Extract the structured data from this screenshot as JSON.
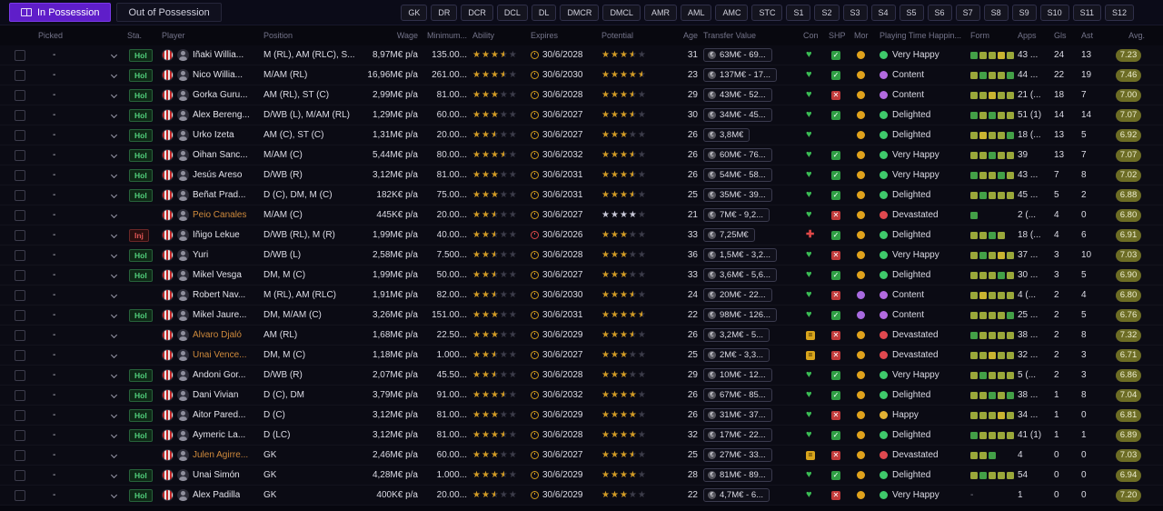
{
  "topbar": {
    "tabs": [
      {
        "label": "In Possession",
        "active": true
      },
      {
        "label": "Out of Possession",
        "active": false
      }
    ],
    "filters": [
      "GK",
      "DR",
      "DCR",
      "DCL",
      "DL",
      "DMCR",
      "DMCL",
      "AMR",
      "AML",
      "AMC",
      "STC",
      "S1",
      "S2",
      "S3",
      "S4",
      "S5",
      "S6",
      "S7",
      "S8",
      "S9",
      "S10",
      "S11",
      "S12"
    ]
  },
  "icons": {
    "star": "★",
    "heart": "♥",
    "check": "✓",
    "cross": "✕",
    "injured": "✚",
    "warning": "=",
    "coin": "€",
    "chevron": "v",
    "clock": "clock-face",
    "club_crest": "red-white-striped-circle",
    "avatar": "person-silhouette"
  },
  "colors": {
    "accent_purple": "#5f1ec9",
    "star_gold": "#d19b26",
    "avg_pill": "#6d6d25",
    "hol_green": "#52d07c",
    "inj_red": "#e05555",
    "listed_orange": "#cf8a3c",
    "happy_green": "#3fc96b",
    "content_purple": "#b26ae0",
    "devastated_red": "#e0484f",
    "happy_yellow": "#e3b133"
  },
  "table": {
    "columns": [
      "",
      "Picked",
      "Sta.",
      "Player",
      "Position",
      "Wage",
      "Minimum...",
      "Ability",
      "Expires",
      "Potential",
      "Age",
      "Transfer Value",
      "Con",
      "SHP",
      "Mor",
      "Playing Time Happin...",
      "Form",
      "Apps",
      "Gls",
      "Ast",
      "Avg."
    ],
    "rows": [
      {
        "picked": "-",
        "sta": "Hol",
        "name": "Iñaki Willia...",
        "listed": false,
        "pos": "M (RL), AM (RLC), S...",
        "wage": "8,97M€ p/a",
        "min": "135.00...",
        "abil": 3.5,
        "exp": "30/6/2028",
        "exp_red": false,
        "pot": 3.5,
        "pot_silver": false,
        "age": "31",
        "val": "63M€ - 69...",
        "con": "heart",
        "shp": "check",
        "mor": "yellow",
        "hap": "Very Happy",
        "hap_c": "green",
        "form": [
          "green",
          "olive",
          "olive",
          "yellow",
          "olive"
        ],
        "apps": "43 ...",
        "gls": "24",
        "ast": "13",
        "avg": "7.23"
      },
      {
        "picked": "-",
        "sta": "Hol",
        "name": "Nico Willia...",
        "listed": false,
        "pos": "M/AM (RL)",
        "wage": "16,96M€ p/a",
        "min": "261.00...",
        "abil": 3.5,
        "exp": "30/6/2030",
        "exp_red": false,
        "pot": 4.5,
        "pot_silver": false,
        "age": "23",
        "val": "137M€ - 17...",
        "con": "heart",
        "shp": "check",
        "mor": "yellow",
        "hap": "Content",
        "hap_c": "purple",
        "form": [
          "olive",
          "green",
          "olive",
          "olive",
          "green"
        ],
        "apps": "44 ...",
        "gls": "22",
        "ast": "19",
        "avg": "7.46"
      },
      {
        "picked": "-",
        "sta": "Hol",
        "name": "Gorka Guru...",
        "listed": false,
        "pos": "AM (RL), ST (C)",
        "wage": "2,99M€ p/a",
        "min": "81.00...",
        "abil": 3,
        "exp": "30/6/2028",
        "exp_red": false,
        "pot": 3.5,
        "pot_silver": false,
        "age": "29",
        "val": "43M€ - 52...",
        "con": "heart",
        "shp": "x",
        "mor": "yellow",
        "hap": "Content",
        "hap_c": "purple",
        "form": [
          "olive",
          "olive",
          "yellow",
          "olive",
          "olive"
        ],
        "apps": "21 (...",
        "gls": "18",
        "ast": "7",
        "avg": "7.00"
      },
      {
        "picked": "-",
        "sta": "Hol",
        "name": "Álex Bereng...",
        "listed": false,
        "pos": "D/WB (L), M/AM (RL)",
        "wage": "1,29M€ p/a",
        "min": "60.00...",
        "abil": 3,
        "exp": "30/6/2027",
        "exp_red": false,
        "pot": 3.5,
        "pot_silver": false,
        "age": "30",
        "val": "34M€ - 45...",
        "con": "heart",
        "shp": "check",
        "mor": "yellow",
        "hap": "Delighted",
        "hap_c": "green",
        "form": [
          "green",
          "olive",
          "green",
          "olive",
          "olive"
        ],
        "apps": "51 (1)",
        "gls": "14",
        "ast": "14",
        "avg": "7.07"
      },
      {
        "picked": "-",
        "sta": "Hol",
        "name": "Urko Izeta",
        "listed": false,
        "pos": "AM (C), ST (C)",
        "wage": "1,31M€ p/a",
        "min": "20.00...",
        "abil": 2.5,
        "exp": "30/6/2027",
        "exp_red": false,
        "pot": 3,
        "pot_silver": false,
        "age": "26",
        "val": "3,8M€",
        "con": "heart",
        "shp": "",
        "mor": "yellow",
        "hap": "Delighted",
        "hap_c": "green",
        "form": [
          "olive",
          "yellow",
          "olive",
          "olive",
          "green"
        ],
        "apps": "18 (...",
        "gls": "13",
        "ast": "5",
        "avg": "6.92"
      },
      {
        "picked": "-",
        "sta": "Hol",
        "name": "Oihan Sanc...",
        "listed": false,
        "pos": "M/AM (C)",
        "wage": "5,44M€ p/a",
        "min": "80.00...",
        "abil": 3.5,
        "exp": "30/6/2032",
        "exp_red": false,
        "pot": 3.5,
        "pot_silver": false,
        "age": "26",
        "val": "60M€ - 76...",
        "con": "heart",
        "shp": "check",
        "mor": "yellow",
        "hap": "Very Happy",
        "hap_c": "green",
        "form": [
          "olive",
          "olive",
          "green",
          "olive",
          "olive"
        ],
        "apps": "39",
        "gls": "13",
        "ast": "7",
        "avg": "7.07"
      },
      {
        "picked": "-",
        "sta": "Hol",
        "name": "Jesús Areso",
        "listed": false,
        "pos": "D/WB (R)",
        "wage": "3,12M€ p/a",
        "min": "81.00...",
        "abil": 3,
        "exp": "30/6/2031",
        "exp_red": false,
        "pot": 3.5,
        "pot_silver": false,
        "age": "26",
        "val": "54M€ - 58...",
        "con": "heart",
        "shp": "check",
        "mor": "yellow",
        "hap": "Very Happy",
        "hap_c": "green",
        "form": [
          "green",
          "olive",
          "olive",
          "green",
          "olive"
        ],
        "apps": "43 ...",
        "gls": "7",
        "ast": "8",
        "avg": "7.02"
      },
      {
        "picked": "-",
        "sta": "Hol",
        "name": "Beñat Prad...",
        "listed": false,
        "pos": "D (C), DM, M (C)",
        "wage": "182K€ p/a",
        "min": "75.00...",
        "abil": 3,
        "exp": "30/6/2031",
        "exp_red": false,
        "pot": 3.5,
        "pot_silver": false,
        "age": "25",
        "val": "35M€ - 39...",
        "con": "heart",
        "shp": "check",
        "mor": "yellow",
        "hap": "Delighted",
        "hap_c": "green",
        "form": [
          "olive",
          "green",
          "olive",
          "olive",
          "olive"
        ],
        "apps": "45 ...",
        "gls": "5",
        "ast": "2",
        "avg": "6.88"
      },
      {
        "picked": "-",
        "sta": "",
        "name": "Peio Canales",
        "listed": true,
        "pos": "M/AM (C)",
        "wage": "445K€ p/a",
        "min": "20.00...",
        "abil": 2.5,
        "exp": "30/6/2027",
        "exp_red": false,
        "pot": 4,
        "pot_silver": true,
        "age": "21",
        "val": "7M€ - 9,2...",
        "con": "heart",
        "shp": "x",
        "mor": "yellow",
        "hap": "Devastated",
        "hap_c": "red",
        "form": [
          "green"
        ],
        "apps": "2 (...",
        "gls": "4",
        "ast": "0",
        "avg": "6.80"
      },
      {
        "picked": "-",
        "sta": "Inj",
        "name": "Íñigo Lekue",
        "listed": false,
        "pos": "D/WB (RL), M (R)",
        "wage": "1,99M€ p/a",
        "min": "40.00...",
        "abil": 2.5,
        "exp": "30/6/2026",
        "exp_red": true,
        "pot": 3,
        "pot_silver": false,
        "age": "33",
        "val": "7,25M€",
        "con": "plus",
        "shp": "check",
        "mor": "yellow",
        "hap": "Delighted",
        "hap_c": "green",
        "form": [
          "olive",
          "olive",
          "green",
          "olive"
        ],
        "apps": "18 (...",
        "gls": "4",
        "ast": "6",
        "avg": "6.91"
      },
      {
        "picked": "-",
        "sta": "Hol",
        "name": "Yuri",
        "listed": false,
        "pos": "D/WB (L)",
        "wage": "2,58M€ p/a",
        "min": "7.500...",
        "abil": 2.5,
        "exp": "30/6/2028",
        "exp_red": false,
        "pot": 3,
        "pot_silver": false,
        "age": "36",
        "val": "1,5M€ - 3,2...",
        "con": "heart",
        "shp": "x",
        "mor": "yellow",
        "hap": "Very Happy",
        "hap_c": "green",
        "form": [
          "olive",
          "green",
          "olive",
          "yellow",
          "olive"
        ],
        "apps": "37 ...",
        "gls": "3",
        "ast": "10",
        "avg": "7.03"
      },
      {
        "picked": "-",
        "sta": "Hol",
        "name": "Mikel Vesga",
        "listed": false,
        "pos": "DM, M (C)",
        "wage": "1,99M€ p/a",
        "min": "50.00...",
        "abil": 2.5,
        "exp": "30/6/2027",
        "exp_red": false,
        "pot": 3,
        "pot_silver": false,
        "age": "33",
        "val": "3,6M€ - 5,6...",
        "con": "heart",
        "shp": "check",
        "mor": "yellow",
        "hap": "Delighted",
        "hap_c": "green",
        "form": [
          "olive",
          "olive",
          "olive",
          "green",
          "olive"
        ],
        "apps": "30 ...",
        "gls": "3",
        "ast": "5",
        "avg": "6.90"
      },
      {
        "picked": "-",
        "sta": "",
        "name": "Robert Nav...",
        "listed": false,
        "pos": "M (RL), AM (RLC)",
        "wage": "1,91M€ p/a",
        "min": "82.00...",
        "abil": 2.5,
        "exp": "30/6/2030",
        "exp_red": false,
        "pot": 3.5,
        "pot_silver": false,
        "age": "24",
        "val": "20M€ - 22...",
        "con": "heart",
        "shp": "x",
        "mor": "purple",
        "hap": "Content",
        "hap_c": "purple",
        "form": [
          "olive",
          "yellow",
          "olive",
          "olive",
          "olive"
        ],
        "apps": "4 (...",
        "gls": "2",
        "ast": "4",
        "avg": "6.80"
      },
      {
        "picked": "-",
        "sta": "Hol",
        "name": "Mikel Jaure...",
        "listed": false,
        "pos": "DM, M/AM (C)",
        "wage": "3,26M€ p/a",
        "min": "151.00...",
        "abil": 3,
        "exp": "30/6/2031",
        "exp_red": false,
        "pot": 4.5,
        "pot_silver": false,
        "age": "22",
        "val": "98M€ - 126...",
        "con": "heart",
        "shp": "check",
        "mor": "purple",
        "hap": "Content",
        "hap_c": "purple",
        "form": [
          "olive",
          "olive",
          "olive",
          "olive",
          "green"
        ],
        "apps": "25 ...",
        "gls": "2",
        "ast": "5",
        "avg": "6.76"
      },
      {
        "picked": "-",
        "sta": "",
        "name": "Álvaro Djaló",
        "listed": true,
        "pos": "AM (RL)",
        "wage": "1,68M€ p/a",
        "min": "22.50...",
        "abil": 3,
        "exp": "30/6/2029",
        "exp_red": false,
        "pot": 3.5,
        "pot_silver": false,
        "age": "26",
        "val": "3,2M€ - 5...",
        "con": "eq",
        "shp": "x",
        "mor": "yellow",
        "hap": "Devastated",
        "hap_c": "red",
        "form": [
          "green",
          "olive",
          "olive",
          "olive",
          "olive"
        ],
        "apps": "38 ...",
        "gls": "2",
        "ast": "8",
        "avg": "7.32"
      },
      {
        "picked": "-",
        "sta": "",
        "name": "Unai Vence...",
        "listed": true,
        "pos": "DM, M (C)",
        "wage": "1,18M€ p/a",
        "min": "1.000...",
        "abil": 2.5,
        "exp": "30/6/2027",
        "exp_red": false,
        "pot": 3,
        "pot_silver": false,
        "age": "25",
        "val": "2M€ - 3,3...",
        "con": "eq",
        "shp": "x",
        "mor": "yellow",
        "hap": "Devastated",
        "hap_c": "red",
        "form": [
          "olive",
          "olive",
          "yellow",
          "olive",
          "olive"
        ],
        "apps": "32 ...",
        "gls": "2",
        "ast": "3",
        "avg": "6.71"
      },
      {
        "picked": "-",
        "sta": "Hol",
        "name": "Andoni Gor...",
        "listed": false,
        "pos": "D/WB (R)",
        "wage": "2,07M€ p/a",
        "min": "45.50...",
        "abil": 2.5,
        "exp": "30/6/2028",
        "exp_red": false,
        "pot": 3,
        "pot_silver": false,
        "age": "29",
        "val": "10M€ - 12...",
        "con": "heart",
        "shp": "check",
        "mor": "yellow",
        "hap": "Very Happy",
        "hap_c": "green",
        "form": [
          "olive",
          "green",
          "olive",
          "olive",
          "olive"
        ],
        "apps": "5 (...",
        "gls": "2",
        "ast": "3",
        "avg": "6.86"
      },
      {
        "picked": "-",
        "sta": "Hol",
        "name": "Dani Vivian",
        "listed": false,
        "pos": "D (C), DM",
        "wage": "3,79M€ p/a",
        "min": "91.00...",
        "abil": 3.5,
        "exp": "30/6/2032",
        "exp_red": false,
        "pot": 4,
        "pot_silver": false,
        "age": "26",
        "val": "67M€ - 85...",
        "con": "heart",
        "shp": "check",
        "mor": "yellow",
        "hap": "Delighted",
        "hap_c": "green",
        "form": [
          "olive",
          "olive",
          "green",
          "olive",
          "green"
        ],
        "apps": "38 ...",
        "gls": "1",
        "ast": "8",
        "avg": "7.04"
      },
      {
        "picked": "-",
        "sta": "Hol",
        "name": "Aitor Pared...",
        "listed": false,
        "pos": "D (C)",
        "wage": "3,12M€ p/a",
        "min": "81.00...",
        "abil": 3,
        "exp": "30/6/2029",
        "exp_red": false,
        "pot": 4,
        "pot_silver": false,
        "age": "26",
        "val": "31M€ - 37...",
        "con": "heart",
        "shp": "x",
        "mor": "yellow",
        "hap": "Happy",
        "hap_c": "yellow",
        "form": [
          "olive",
          "olive",
          "olive",
          "yellow",
          "olive"
        ],
        "apps": "34 ...",
        "gls": "1",
        "ast": "0",
        "avg": "6.81"
      },
      {
        "picked": "-",
        "sta": "Hol",
        "name": "Aymeric La...",
        "listed": false,
        "pos": "D (LC)",
        "wage": "3,12M€ p/a",
        "min": "81.00...",
        "abil": 3.5,
        "exp": "30/6/2028",
        "exp_red": false,
        "pot": 4,
        "pot_silver": false,
        "age": "32",
        "val": "17M€ - 22...",
        "con": "heart",
        "shp": "check",
        "mor": "yellow",
        "hap": "Delighted",
        "hap_c": "green",
        "form": [
          "green",
          "olive",
          "olive",
          "olive",
          "olive"
        ],
        "apps": "41 (1)",
        "gls": "1",
        "ast": "1",
        "avg": "6.89"
      },
      {
        "picked": "-",
        "sta": "",
        "name": "Julen Agirre...",
        "listed": true,
        "pos": "GK",
        "wage": "2,46M€ p/a",
        "min": "60.00...",
        "abil": 3,
        "exp": "30/6/2027",
        "exp_red": false,
        "pot": 3.5,
        "pot_silver": false,
        "age": "25",
        "val": "27M€ - 33...",
        "con": "eq",
        "shp": "x",
        "mor": "yellow",
        "hap": "Devastated",
        "hap_c": "red",
        "form": [
          "olive",
          "olive",
          "green"
        ],
        "apps": "4",
        "gls": "0",
        "ast": "0",
        "avg": "7.03"
      },
      {
        "picked": "-",
        "sta": "Hol",
        "name": "Unai Simón",
        "listed": false,
        "pos": "GK",
        "wage": "4,28M€ p/a",
        "min": "1.000...",
        "abil": 3.5,
        "exp": "30/6/2029",
        "exp_red": false,
        "pot": 4,
        "pot_silver": false,
        "age": "28",
        "val": "81M€ - 89...",
        "con": "heart",
        "shp": "check",
        "mor": "yellow",
        "hap": "Delighted",
        "hap_c": "green",
        "form": [
          "olive",
          "green",
          "olive",
          "olive",
          "olive"
        ],
        "apps": "54",
        "gls": "0",
        "ast": "0",
        "avg": "6.94"
      },
      {
        "picked": "-",
        "sta": "Hol",
        "name": "Álex Padilla",
        "listed": false,
        "pos": "GK",
        "wage": "400K€ p/a",
        "min": "20.00...",
        "abil": 2.5,
        "exp": "30/6/2029",
        "exp_red": false,
        "pot": 3,
        "pot_silver": false,
        "age": "22",
        "val": "4,7M€ - 6...",
        "con": "heart",
        "shp": "x",
        "mor": "yellow",
        "hap": "Very Happy",
        "hap_c": "green",
        "form": [],
        "apps": "1",
        "gls": "0",
        "ast": "0",
        "avg": "7.20"
      }
    ]
  }
}
